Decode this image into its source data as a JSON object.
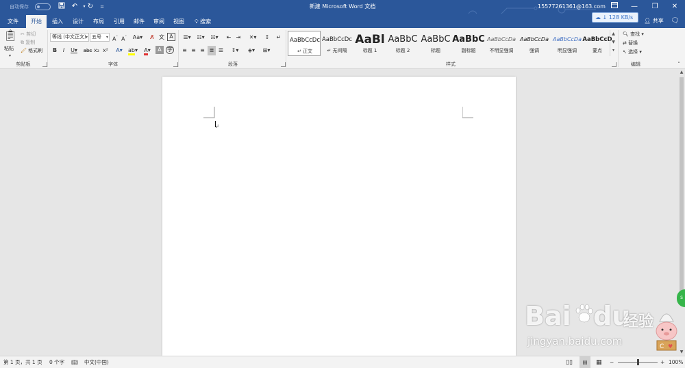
{
  "titlebar": {
    "autosave_label": "自动保存",
    "autosave_toggle": "关",
    "doc_title": "新建 Microsoft Word 文档",
    "account": "15577261361@163.com"
  },
  "tabs": [
    {
      "label": "文件",
      "active": false
    },
    {
      "label": "开始",
      "active": true
    },
    {
      "label": "插入",
      "active": false
    },
    {
      "label": "设计",
      "active": false
    },
    {
      "label": "布局",
      "active": false
    },
    {
      "label": "引用",
      "active": false
    },
    {
      "label": "邮件",
      "active": false
    },
    {
      "label": "审阅",
      "active": false
    },
    {
      "label": "视图",
      "active": false
    }
  ],
  "tell_me": "搜索",
  "download_speed": "128 KB/s",
  "share_label": "共享",
  "ribbon": {
    "clipboard": {
      "label": "剪贴板",
      "paste": "粘贴",
      "cut": "剪切",
      "copy": "复制",
      "format_painter": "格式刷"
    },
    "font": {
      "label": "字体",
      "font_name": "等线 (中文正文)",
      "font_size": "五号"
    },
    "paragraph": {
      "label": "段落"
    },
    "styles": {
      "label": "样式",
      "items": [
        {
          "sample": "AaBbCcDc",
          "name": "正文",
          "selected": true
        },
        {
          "sample": "AaBbCcDc",
          "name": "无间隔",
          "selected": false
        },
        {
          "sample": "AaBl",
          "name": "标题 1",
          "selected": false
        },
        {
          "sample": "AaBbC",
          "name": "标题 2",
          "selected": false
        },
        {
          "sample": "AaBbC",
          "name": "标题",
          "selected": false
        },
        {
          "sample": "AaBbC",
          "name": "副标题",
          "selected": false
        },
        {
          "sample": "AaBbCcDa",
          "name": "不明显强调",
          "selected": false
        },
        {
          "sample": "AaBbCcDa",
          "name": "强调",
          "selected": false
        },
        {
          "sample": "AaBbCcDa",
          "name": "明显强调",
          "selected": false
        },
        {
          "sample": "AaBbCcD",
          "name": "要点",
          "selected": false
        }
      ]
    },
    "editing": {
      "label": "编辑",
      "find": "查找",
      "replace": "替换",
      "select": "选择"
    }
  },
  "statusbar": {
    "page": "第 1 页，共 1 页",
    "words": "0 个字",
    "language": "中文(中国)",
    "zoom": "100%",
    "zoom_level": 0.5
  },
  "watermark": {
    "brand": "Bai",
    "brand2": "du",
    "brand_cn": "经验",
    "url": "jingyan.baidu.com"
  },
  "colors": {
    "title_blue": "#2b579a",
    "ribbon_bg": "#f3f3f3",
    "canvas_bg": "#e6e6e6"
  }
}
